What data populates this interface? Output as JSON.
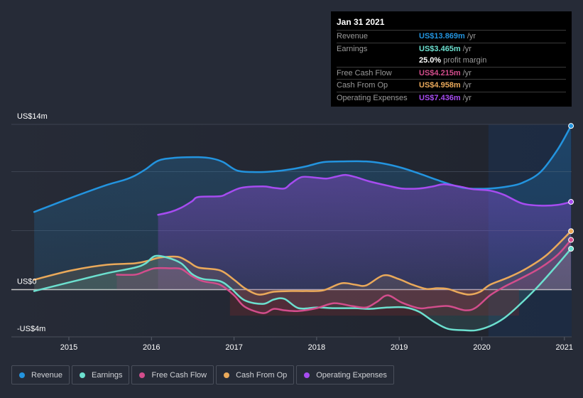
{
  "tooltip": {
    "date": "Jan 31 2021",
    "rows": [
      {
        "label": "Revenue",
        "value": "US$13.869m",
        "unit": "/yr",
        "color": "#2394df"
      },
      {
        "label": "Earnings",
        "value": "US$3.465m",
        "unit": "/yr",
        "color": "#6ce0cf"
      },
      {
        "label": "",
        "value": "25.0%",
        "unit": "profit margin",
        "color": "#ffffff"
      },
      {
        "label": "Free Cash Flow",
        "value": "US$4.215m",
        "unit": "/yr",
        "color": "#d34d8c"
      },
      {
        "label": "Cash From Op",
        "value": "US$4.958m",
        "unit": "/yr",
        "color": "#eaa95a"
      },
      {
        "label": "Operating Expenses",
        "value": "US$7.436m",
        "unit": "/yr",
        "color": "#a64cf0"
      }
    ]
  },
  "legend": [
    {
      "label": "Revenue",
      "color": "#2394df"
    },
    {
      "label": "Earnings",
      "color": "#6ce0cf"
    },
    {
      "label": "Free Cash Flow",
      "color": "#d34d8c"
    },
    {
      "label": "Cash From Op",
      "color": "#eaa95a"
    },
    {
      "label": "Operating Expenses",
      "color": "#a64cf0"
    }
  ],
  "chart_data": {
    "type": "line",
    "title": "",
    "xlabel": "",
    "ylabel": "",
    "ylim": [
      -4,
      14
    ],
    "xlim": [
      2014.58,
      2021.08
    ],
    "y_tick_labels": [
      {
        "value": 14,
        "label": "US$14m"
      },
      {
        "value": 0,
        "label": "US$0"
      },
      {
        "value": -4,
        "label": "-US$4m"
      }
    ],
    "y_gridlines": [
      14,
      10,
      5,
      0,
      -4
    ],
    "x_ticks": [
      {
        "value": 2015,
        "label": "2015"
      },
      {
        "value": 2016,
        "label": "2016"
      },
      {
        "value": 2017,
        "label": "2017"
      },
      {
        "value": 2018,
        "label": "2018"
      },
      {
        "value": 2019,
        "label": "2019"
      },
      {
        "value": 2020,
        "label": "2020"
      },
      {
        "value": 2021,
        "label": "2021"
      }
    ],
    "forecast_shade_start": 2020.08,
    "series": [
      {
        "name": "Revenue",
        "color": "#2394df",
        "x": [
          2014.58,
          2015.03,
          2015.46,
          2015.67,
          2015.8,
          2015.93,
          2016.08,
          2016.27,
          2016.57,
          2016.74,
          2016.87,
          2017.04,
          2017.26,
          2017.48,
          2017.69,
          2017.87,
          2018.08,
          2018.3,
          2018.6,
          2018.81,
          2019.03,
          2019.24,
          2019.46,
          2019.67,
          2019.84,
          2020.1,
          2020.32,
          2020.49,
          2020.71,
          2020.92,
          2021.08
        ],
        "values": [
          6.58,
          7.79,
          8.87,
          9.29,
          9.66,
          10.2,
          10.92,
          11.16,
          11.22,
          11.1,
          10.8,
          10.08,
          9.96,
          10.02,
          10.2,
          10.44,
          10.8,
          10.86,
          10.86,
          10.68,
          10.32,
          9.84,
          9.29,
          8.81,
          8.57,
          8.57,
          8.75,
          9.05,
          9.96,
          11.89,
          13.869
        ]
      },
      {
        "name": "Earnings",
        "color": "#6ce0cf",
        "x": [
          2014.58,
          2015.03,
          2015.46,
          2015.8,
          2015.93,
          2016.04,
          2016.19,
          2016.36,
          2016.49,
          2016.62,
          2016.83,
          2016.96,
          2017.13,
          2017.35,
          2017.48,
          2017.61,
          2017.78,
          2018.0,
          2018.21,
          2018.47,
          2018.64,
          2018.86,
          2019.07,
          2019.24,
          2019.42,
          2019.59,
          2019.8,
          2019.93,
          2020.1,
          2020.27,
          2020.44,
          2020.66,
          2020.87,
          2021.08
        ],
        "values": [
          -0.12,
          0.66,
          1.39,
          1.87,
          2.23,
          2.84,
          2.72,
          2.23,
          1.33,
          0.91,
          0.72,
          0.12,
          -0.91,
          -1.21,
          -0.84,
          -0.78,
          -1.57,
          -1.51,
          -1.57,
          -1.57,
          -1.63,
          -1.51,
          -1.51,
          -1.87,
          -2.72,
          -3.32,
          -3.44,
          -3.44,
          -3.08,
          -2.41,
          -1.39,
          0.12,
          1.75,
          3.465
        ]
      },
      {
        "name": "Free Cash Flow",
        "color": "#d34d8c",
        "x": [
          2015.58,
          2015.8,
          2015.93,
          2016.04,
          2016.23,
          2016.36,
          2016.49,
          2016.62,
          2016.83,
          2017.0,
          2017.13,
          2017.35,
          2017.48,
          2017.61,
          2017.78,
          2018.0,
          2018.21,
          2018.43,
          2018.6,
          2018.73,
          2018.86,
          2019.03,
          2019.24,
          2019.37,
          2019.59,
          2019.8,
          2019.93,
          2020.1,
          2020.27,
          2020.44,
          2020.7,
          2020.92,
          2021.08
        ],
        "values": [
          1.27,
          1.27,
          1.57,
          1.81,
          1.81,
          1.75,
          1.15,
          0.72,
          0.42,
          -0.48,
          -1.45,
          -1.99,
          -1.63,
          -1.75,
          -1.81,
          -1.57,
          -1.15,
          -1.39,
          -1.51,
          -1.03,
          -0.48,
          -1.09,
          -1.57,
          -1.51,
          -1.39,
          -1.75,
          -1.51,
          -0.48,
          0.24,
          0.84,
          1.81,
          2.96,
          4.215
        ]
      },
      {
        "name": "Cash From Op",
        "color": "#eaa95a",
        "x": [
          2014.58,
          2015.03,
          2015.46,
          2015.8,
          2015.97,
          2016.1,
          2016.32,
          2016.45,
          2016.57,
          2016.83,
          2017.0,
          2017.13,
          2017.3,
          2017.48,
          2017.69,
          2017.87,
          2018.08,
          2018.3,
          2018.47,
          2018.6,
          2018.81,
          2018.99,
          2019.16,
          2019.33,
          2019.46,
          2019.59,
          2019.72,
          2019.85,
          2019.98,
          2020.1,
          2020.32,
          2020.53,
          2020.79,
          2021.08
        ],
        "values": [
          0.84,
          1.63,
          2.11,
          2.23,
          2.47,
          2.72,
          2.78,
          2.35,
          1.87,
          1.63,
          0.84,
          0.12,
          -0.42,
          -0.18,
          -0.12,
          -0.12,
          -0.06,
          0.54,
          0.42,
          0.36,
          1.21,
          0.91,
          0.42,
          0.06,
          0.12,
          0.06,
          -0.24,
          -0.42,
          -0.18,
          0.42,
          1.03,
          1.75,
          2.96,
          4.958
        ]
      },
      {
        "name": "Operating Expenses",
        "color": "#a64cf0",
        "x": [
          2016.08,
          2016.23,
          2016.36,
          2016.49,
          2016.57,
          2016.83,
          2016.92,
          2017.09,
          2017.35,
          2017.48,
          2017.61,
          2017.69,
          2017.82,
          2018.0,
          2018.12,
          2018.25,
          2018.35,
          2018.47,
          2018.64,
          2018.86,
          2019.03,
          2019.24,
          2019.41,
          2019.54,
          2019.72,
          2019.89,
          2020.1,
          2020.27,
          2020.49,
          2020.71,
          2020.92,
          2021.08
        ],
        "values": [
          6.34,
          6.58,
          6.94,
          7.48,
          7.85,
          7.91,
          8.15,
          8.63,
          8.75,
          8.63,
          8.57,
          8.99,
          9.54,
          9.48,
          9.41,
          9.6,
          9.72,
          9.54,
          9.17,
          8.81,
          8.57,
          8.57,
          8.75,
          8.93,
          8.75,
          8.51,
          8.39,
          8.03,
          7.3,
          7.12,
          7.18,
          7.436
        ]
      }
    ]
  }
}
